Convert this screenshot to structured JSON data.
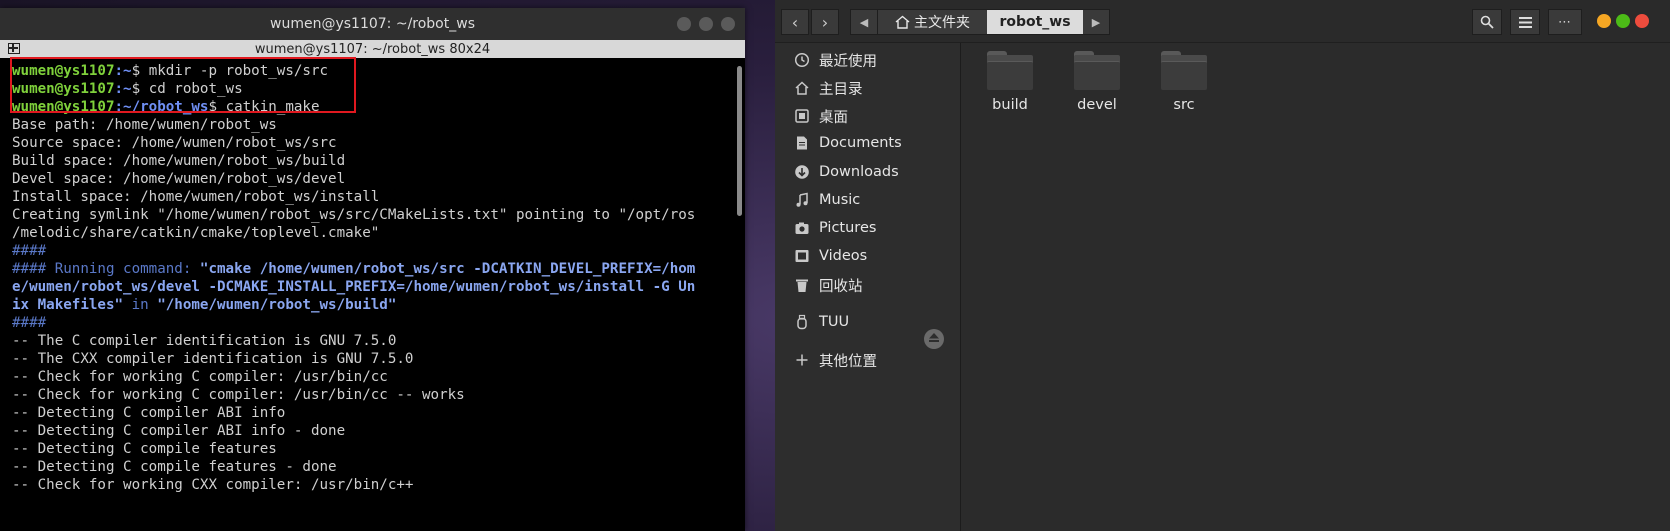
{
  "terminal": {
    "window_title": "wumen@ys1107: ~/robot_ws",
    "tab_title": "wumen@ys1107: ~/robot_ws 80x24",
    "lines": [
      {
        "type": "prompt",
        "user": "wumen@ys1107",
        "path": ":~",
        "sym": "$ ",
        "cmd": "mkdir -p robot_ws/src"
      },
      {
        "type": "prompt",
        "user": "wumen@ys1107",
        "path": ":~",
        "sym": "$ ",
        "cmd": "cd robot_ws"
      },
      {
        "type": "prompt",
        "user": "wumen@ys1107",
        "path": ":~/robot_ws",
        "sym": "$ ",
        "cmd": "catkin_make"
      },
      {
        "type": "text",
        "text": "Base path: /home/wumen/robot_ws"
      },
      {
        "type": "text",
        "text": "Source space: /home/wumen/robot_ws/src"
      },
      {
        "type": "text",
        "text": "Build space: /home/wumen/robot_ws/build"
      },
      {
        "type": "text",
        "text": "Devel space: /home/wumen/robot_ws/devel"
      },
      {
        "type": "text",
        "text": "Install space: /home/wumen/robot_ws/install"
      },
      {
        "type": "text",
        "text": "Creating symlink \"/home/wumen/robot_ws/src/CMakeLists.txt\" pointing to \"/opt/ros"
      },
      {
        "type": "text",
        "text": "/melodic/share/catkin/cmake/toplevel.cmake\""
      },
      {
        "type": "hash",
        "text": "####"
      },
      {
        "type": "cmake1",
        "label": "#### Running command: ",
        "strong": "\"cmake /home/wumen/robot_ws/src -DCATKIN_DEVEL_PREFIX=/hom"
      },
      {
        "type": "strongline",
        "text": "e/wumen/robot_ws/devel -DCMAKE_INSTALL_PREFIX=/home/wumen/robot_ws/install -G Un"
      },
      {
        "type": "cmake3",
        "strong1": "ix Makefiles\"",
        "mid": " in ",
        "strong2": "\"/home/wumen/robot_ws/build\""
      },
      {
        "type": "hash",
        "text": "####"
      },
      {
        "type": "text",
        "text": "-- The C compiler identification is GNU 7.5.0"
      },
      {
        "type": "text",
        "text": "-- The CXX compiler identification is GNU 7.5.0"
      },
      {
        "type": "text",
        "text": "-- Check for working C compiler: /usr/bin/cc"
      },
      {
        "type": "text",
        "text": "-- Check for working C compiler: /usr/bin/cc -- works"
      },
      {
        "type": "text",
        "text": "-- Detecting C compiler ABI info"
      },
      {
        "type": "text",
        "text": "-- Detecting C compiler ABI info - done"
      },
      {
        "type": "text",
        "text": "-- Detecting C compile features"
      },
      {
        "type": "text",
        "text": "-- Detecting C compile features - done"
      },
      {
        "type": "text",
        "text": "-- Check for working CXX compiler: /usr/bin/c++"
      }
    ]
  },
  "files": {
    "path_home": "主文件夹",
    "path_current": "robot_ws",
    "sidebar": [
      {
        "label": "最近使用",
        "icon": "recent-icon"
      },
      {
        "label": "主目录",
        "icon": "home-icon"
      },
      {
        "label": "桌面",
        "icon": "desktop-icon"
      },
      {
        "label": "Documents",
        "icon": "documents-icon"
      },
      {
        "label": "Downloads",
        "icon": "downloads-icon"
      },
      {
        "label": "Music",
        "icon": "music-icon"
      },
      {
        "label": "Pictures",
        "icon": "pictures-icon"
      },
      {
        "label": "Videos",
        "icon": "videos-icon"
      },
      {
        "label": "回收站",
        "icon": "trash-icon"
      },
      {
        "label": "TUU",
        "icon": "usb-drive-icon"
      },
      {
        "label": "其他位置",
        "icon": "plus-icon"
      }
    ],
    "folders": [
      "build",
      "devel",
      "src"
    ],
    "window_controls": {
      "minimize": "#f5a623",
      "maximize": "#4cbb17",
      "close": "#ed4c3d"
    }
  }
}
